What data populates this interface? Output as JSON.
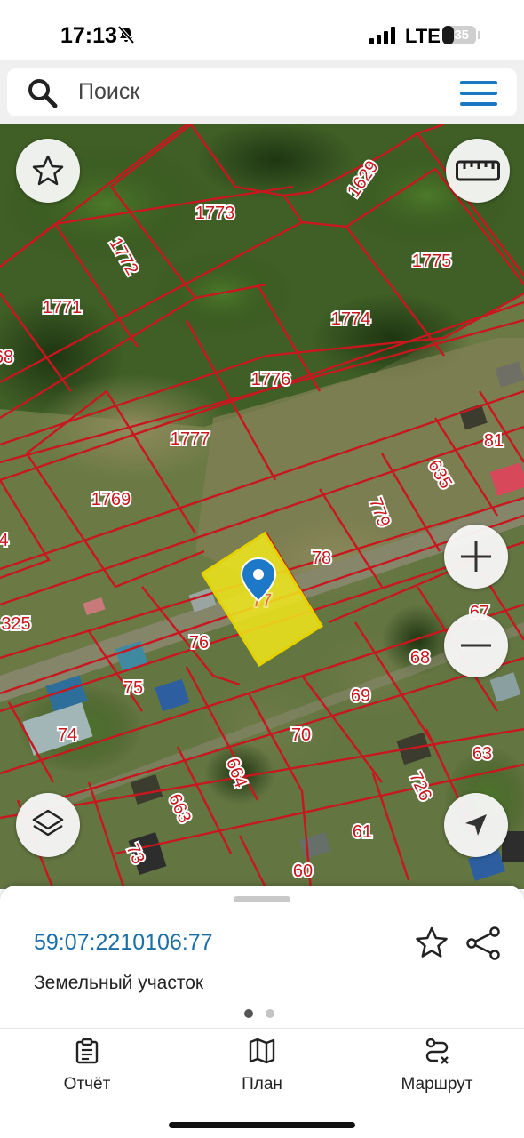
{
  "status": {
    "time": "17:13",
    "network": "LTE",
    "battery": "35",
    "battery_level": 0.35
  },
  "search": {
    "placeholder": "Поиск"
  },
  "map": {
    "selected_parcel_label": "77",
    "parcel_labels": [
      "1773",
      "1629",
      "1772",
      "1775",
      "1771",
      "1774",
      "68",
      "1776",
      "1777",
      "81",
      "1769",
      "635",
      "779",
      "78",
      "4",
      "325",
      "76",
      "67",
      "68",
      "75",
      "69",
      "74",
      "70",
      "63",
      "664",
      "726",
      "663",
      "61",
      "73",
      "60"
    ],
    "colors": {
      "boundary": "#c8171e",
      "label_text": "#c8171e",
      "selected_fill": "#f1e81c",
      "selected_border": "#e3d200",
      "pin": "#1e78c8"
    }
  },
  "sheet": {
    "cadastral_number": "59:07:2210106:77",
    "object_type": "Земельный участок",
    "page_index": 1,
    "page_count": 2
  },
  "tabs": [
    {
      "label": "Отчёт",
      "icon": "report-icon"
    },
    {
      "label": "План",
      "icon": "map-plan-icon"
    },
    {
      "label": "Маршрут",
      "icon": "route-icon"
    }
  ],
  "colors": {
    "accent": "#1a6fa8",
    "menu_icon": "#1a78c2"
  }
}
